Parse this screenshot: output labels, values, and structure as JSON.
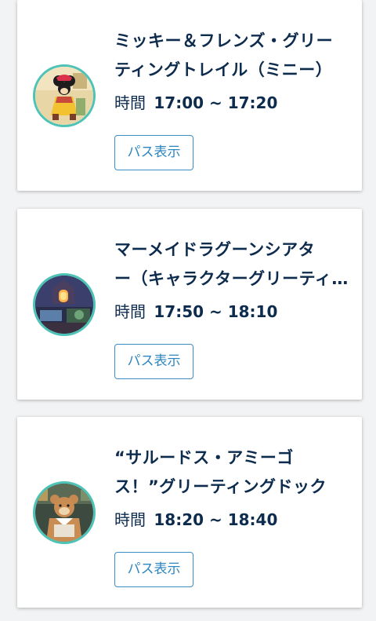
{
  "cards": [
    {
      "title_lines": [
        "ミッキー＆フレンズ・グリー",
        "ティングトレイル（ミニー）"
      ],
      "time_label": "時間",
      "time_value": "17:00 ~ 17:20",
      "button_label": "パス表示",
      "avatar_icon": "minnie-mouse-avatar-icon",
      "accent_color": "#4cc3b6"
    },
    {
      "title_lines": [
        "マーメイドラグーンシアタ",
        "ー（キャラクターグリーティ…"
      ],
      "time_label": "時間",
      "time_value": "17:50 ~ 18:10",
      "button_label": "パス表示",
      "avatar_icon": "mermaid-lagoon-theater-avatar-icon",
      "accent_color": "#4cc3b6"
    },
    {
      "title_lines": [
        "“サルードス・アミーゴ",
        "ス！”グリーティングドック"
      ],
      "time_label": "時間",
      "time_value": "18:20 ~ 18:40",
      "button_label": "パス表示",
      "avatar_icon": "duffy-bear-avatar-icon",
      "accent_color": "#4cc3b6"
    }
  ],
  "colors": {
    "title_text": "#0d2b4d",
    "button_border": "#3b8fc4",
    "button_text": "#2d86bf",
    "avatar_ring": "#4cc3b6",
    "background": "#f2f3f4"
  }
}
